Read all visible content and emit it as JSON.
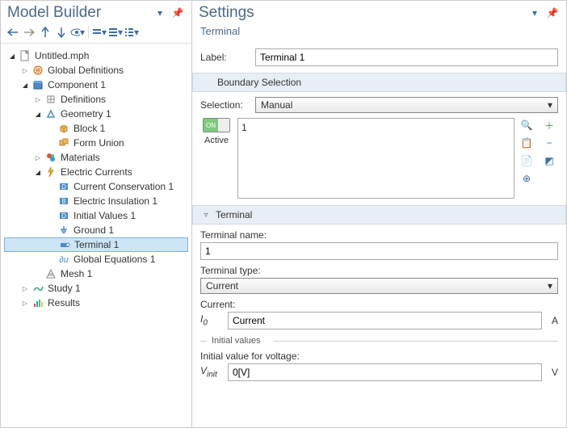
{
  "left": {
    "title": "Model Builder",
    "tree": [
      {
        "depth": 0,
        "tw": "▿",
        "icon": "file",
        "label": "Untitled.mph"
      },
      {
        "depth": 1,
        "tw": "▹",
        "icon": "globe",
        "label": "Global Definitions"
      },
      {
        "depth": 1,
        "tw": "▿",
        "icon": "component",
        "label": "Component 1"
      },
      {
        "depth": 2,
        "tw": "▹",
        "icon": "defs",
        "label": "Definitions"
      },
      {
        "depth": 2,
        "tw": "▿",
        "icon": "geom",
        "label": "Geometry 1"
      },
      {
        "depth": 3,
        "tw": "",
        "icon": "block",
        "label": "Block 1"
      },
      {
        "depth": 3,
        "tw": "",
        "icon": "union",
        "label": "Form Union"
      },
      {
        "depth": 2,
        "tw": "▹",
        "icon": "materials",
        "label": "Materials"
      },
      {
        "depth": 2,
        "tw": "▿",
        "icon": "ec",
        "label": "Electric Currents"
      },
      {
        "depth": 3,
        "tw": "",
        "icon": "cc",
        "label": "Current Conservation 1"
      },
      {
        "depth": 3,
        "tw": "",
        "icon": "ei",
        "label": "Electric Insulation 1"
      },
      {
        "depth": 3,
        "tw": "",
        "icon": "iv",
        "label": "Initial Values 1"
      },
      {
        "depth": 3,
        "tw": "",
        "icon": "gnd",
        "label": "Ground 1"
      },
      {
        "depth": 3,
        "tw": "",
        "icon": "term",
        "label": "Terminal 1",
        "selected": true
      },
      {
        "depth": 3,
        "tw": "",
        "icon": "ge",
        "label": "Global Equations 1"
      },
      {
        "depth": 2,
        "tw": "",
        "icon": "mesh",
        "label": "Mesh 1"
      },
      {
        "depth": 1,
        "tw": "▹",
        "icon": "study",
        "label": "Study 1"
      },
      {
        "depth": 1,
        "tw": "▹",
        "icon": "results",
        "label": "Results"
      }
    ]
  },
  "right": {
    "title": "Settings",
    "subtitle": "Terminal",
    "label_field": "Label:",
    "label_value": "Terminal 1",
    "boundary_section": "Boundary Selection",
    "selection_field": "Selection:",
    "selection_value": "Manual",
    "active_label": "Active",
    "list_item": "1",
    "terminal_section": "Terminal",
    "terminal_name_label": "Terminal name:",
    "terminal_name_value": "1",
    "terminal_type_label": "Terminal type:",
    "terminal_type_value": "Current",
    "current_label": "Current:",
    "current_sym": "I₀",
    "current_value": "Current",
    "current_unit": "A",
    "initial_values_label": "Initial values",
    "init_voltage_label": "Initial value for voltage:",
    "init_voltage_sym": "Vinit",
    "init_voltage_value": "0[V]",
    "init_voltage_unit": "V"
  }
}
